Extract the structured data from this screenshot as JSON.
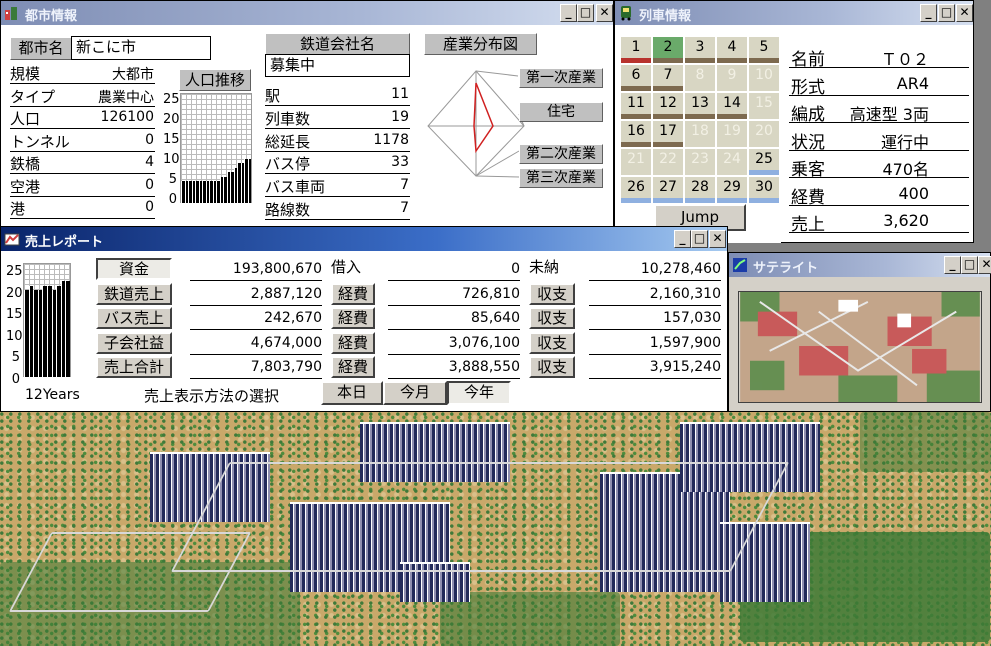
{
  "city_window": {
    "title": "都市情報",
    "city_name_label": "都市名",
    "city_name_value": "新こに市",
    "rows": [
      {
        "label": "規模",
        "value": "大都市"
      },
      {
        "label": "タイプ",
        "value": "農業中心"
      },
      {
        "label": "人口",
        "value": "126100"
      },
      {
        "label": "トンネル",
        "value": "0"
      },
      {
        "label": "鉄橋",
        "value": "4"
      },
      {
        "label": "空港",
        "value": "0"
      },
      {
        "label": "港",
        "value": "0"
      }
    ],
    "pop_chart_title": "人口推移",
    "pop_axis": [
      "25",
      "20",
      "15",
      "10",
      "5",
      "0"
    ],
    "pop_values": [
      5,
      5,
      5,
      5,
      5,
      5,
      5,
      5,
      5,
      5,
      5,
      6,
      6,
      7,
      7,
      8,
      9,
      9,
      10,
      10
    ],
    "company_label": "鉄道会社名",
    "company_value": "募集中",
    "company_rows": [
      {
        "label": "駅",
        "value": "11"
      },
      {
        "label": "列車数",
        "value": "19"
      },
      {
        "label": "総延長",
        "value": "1178"
      },
      {
        "label": "バス停",
        "value": "33"
      },
      {
        "label": "バス車両",
        "value": "7"
      },
      {
        "label": "路線数",
        "value": "7"
      }
    ],
    "industry_title": "産業分布図",
    "industry_labels": [
      "第一次産業",
      "住宅",
      "第二次産業",
      "第三次産業"
    ]
  },
  "train_window": {
    "title": "列車情報",
    "schedule": [
      {
        "n": "1",
        "state": "normal",
        "bar": "#b8332e"
      },
      {
        "n": "2",
        "state": "active",
        "bar": "#7d6a4f"
      },
      {
        "n": "3",
        "state": "normal",
        "bar": "#7d6a4f"
      },
      {
        "n": "4",
        "state": "normal",
        "bar": "#7d6a4f"
      },
      {
        "n": "5",
        "state": "normal",
        "bar": "#7d6a4f"
      },
      {
        "n": "6",
        "state": "normal",
        "bar": "#7d6a4f"
      },
      {
        "n": "7",
        "state": "normal",
        "bar": "#7d6a4f"
      },
      {
        "n": "8",
        "state": "dim",
        "bar": ""
      },
      {
        "n": "9",
        "state": "dim",
        "bar": ""
      },
      {
        "n": "10",
        "state": "dim",
        "bar": ""
      },
      {
        "n": "11",
        "state": "normal",
        "bar": "#7d6a4f"
      },
      {
        "n": "12",
        "state": "normal",
        "bar": "#7d6a4f"
      },
      {
        "n": "13",
        "state": "normal",
        "bar": "#7d6a4f"
      },
      {
        "n": "14",
        "state": "normal",
        "bar": "#7d6a4f"
      },
      {
        "n": "15",
        "state": "dim",
        "bar": ""
      },
      {
        "n": "16",
        "state": "normal",
        "bar": "#7d6a4f"
      },
      {
        "n": "17",
        "state": "normal",
        "bar": "#7d6a4f"
      },
      {
        "n": "18",
        "state": "dim",
        "bar": ""
      },
      {
        "n": "19",
        "state": "dim",
        "bar": ""
      },
      {
        "n": "20",
        "state": "dim",
        "bar": ""
      },
      {
        "n": "21",
        "state": "dim",
        "bar": ""
      },
      {
        "n": "22",
        "state": "dim",
        "bar": ""
      },
      {
        "n": "23",
        "state": "dim",
        "bar": ""
      },
      {
        "n": "24",
        "state": "dim",
        "bar": ""
      },
      {
        "n": "25",
        "state": "normal",
        "bar": "#8fb0e0"
      },
      {
        "n": "26",
        "state": "normal",
        "bar": "#8fb0e0"
      },
      {
        "n": "27",
        "state": "normal",
        "bar": "#8fb0e0"
      },
      {
        "n": "28",
        "state": "normal",
        "bar": "#8fb0e0"
      },
      {
        "n": "29",
        "state": "normal",
        "bar": "#8fb0e0"
      },
      {
        "n": "30",
        "state": "normal",
        "bar": "#8fb0e0"
      }
    ],
    "jump_label": "Jump",
    "details": [
      {
        "label": "名前",
        "value": "Ｔ０２"
      },
      {
        "label": "形式",
        "value": "AR4"
      },
      {
        "label": "編成",
        "value": "高速型 3両"
      },
      {
        "label": "状況",
        "value": "運行中"
      },
      {
        "label": "乗客",
        "value": "470名"
      },
      {
        "label": "経費",
        "value": "400"
      },
      {
        "label": "売上",
        "value": "3,620"
      }
    ]
  },
  "sales_window": {
    "title": "売上レポート",
    "axis": [
      "25",
      "20",
      "15",
      "10",
      "5",
      "0"
    ],
    "bar_values": [
      19,
      20,
      19,
      19,
      20,
      20,
      19,
      20,
      21,
      21
    ],
    "years_label": "12Years",
    "col1_labels": [
      "資金",
      "鉄道売上",
      "バス売上",
      "子会社益",
      "売上合計"
    ],
    "col1_values": [
      "193,800,670",
      "2,887,120",
      "242,670",
      "4,674,000",
      "7,803,790"
    ],
    "col2_labels": [
      "借入",
      "経費",
      "経費",
      "経費",
      "経費"
    ],
    "col2_values": [
      "0",
      "726,810",
      "85,640",
      "3,076,100",
      "3,888,550"
    ],
    "col3_labels": [
      "未納",
      "収支",
      "収支",
      "収支",
      "収支"
    ],
    "col3_values": [
      "10,278,460",
      "2,160,310",
      "157,030",
      "1,597,900",
      "3,915,240"
    ],
    "method_label": "売上表示方法の選択",
    "period_tabs": [
      "本日",
      "今月",
      "今年"
    ]
  },
  "satellite_window": {
    "title": "サテライト"
  }
}
